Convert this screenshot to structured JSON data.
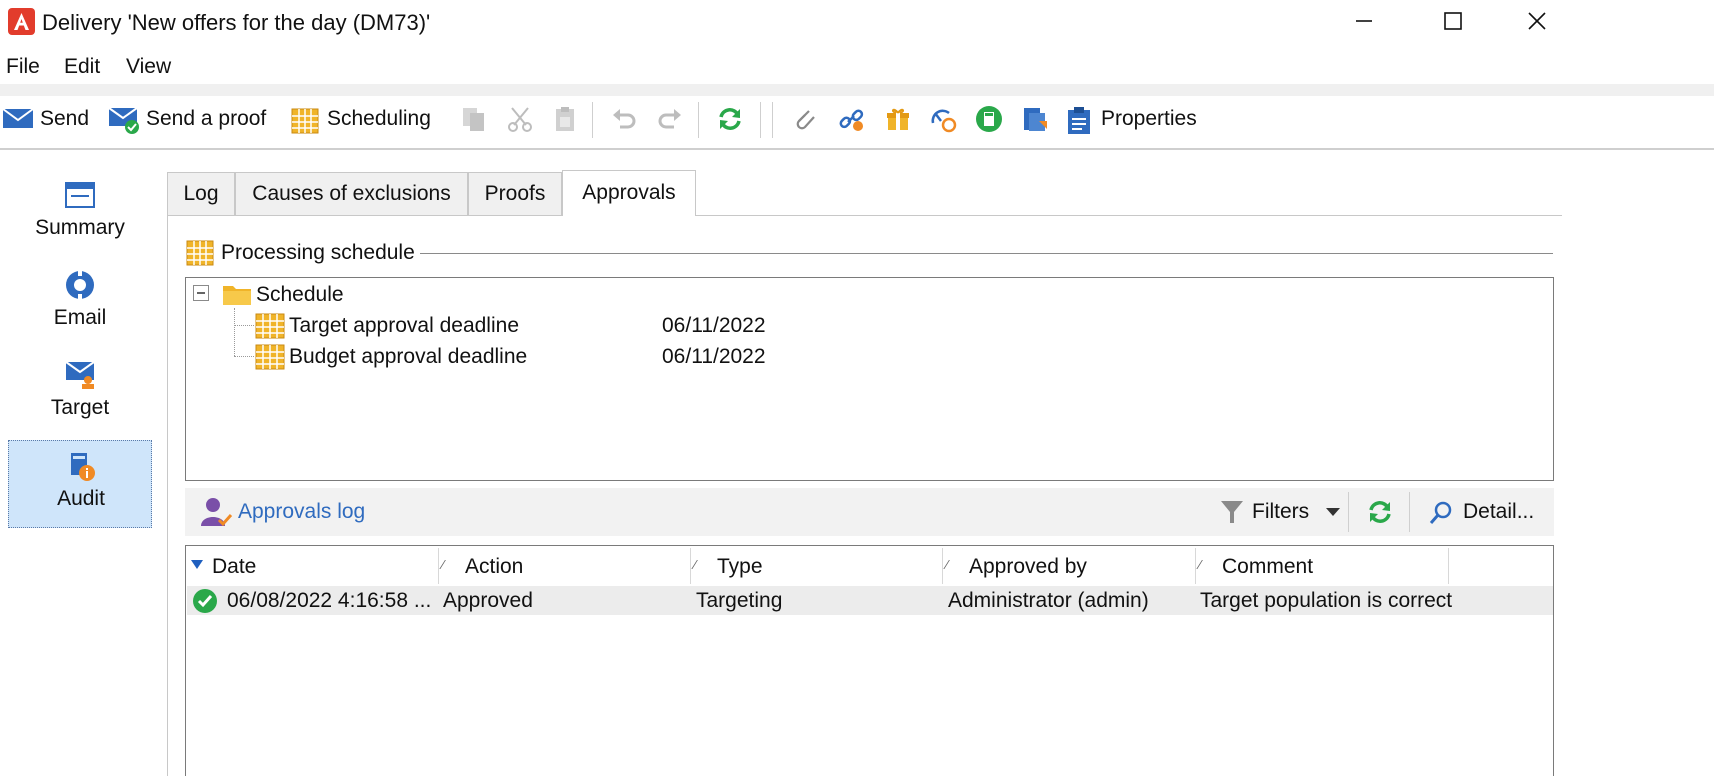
{
  "window": {
    "title": "Delivery 'New offers for the day (DM73)'",
    "controls": [
      "minimize",
      "maximize",
      "close"
    ]
  },
  "menu": {
    "file": "File",
    "edit": "Edit",
    "view": "View"
  },
  "toolbar": {
    "send": "Send",
    "send_proof": "Send a proof",
    "scheduling": "Scheduling",
    "properties": "Properties"
  },
  "nav": {
    "summary": "Summary",
    "email": "Email",
    "target": "Target",
    "audit": "Audit",
    "selected": "Audit"
  },
  "tabs": {
    "log": "Log",
    "causes": "Causes of exclusions",
    "proofs": "Proofs",
    "approvals": "Approvals",
    "active": "Approvals"
  },
  "schedule": {
    "section_title": "Processing schedule",
    "root": "Schedule",
    "items": [
      {
        "label": "Target approval deadline",
        "date": "06/11/2022"
      },
      {
        "label": "Budget approval deadline",
        "date": "06/11/2022"
      }
    ]
  },
  "approvals_log": {
    "title": "Approvals log",
    "filters": "Filters",
    "detail": "Detail...",
    "columns": [
      "Date",
      "Action",
      "Type",
      "Approved by",
      "Comment"
    ],
    "rows": [
      {
        "status": "approved",
        "date": "06/08/2022 4:16:58 ...",
        "action": "Approved",
        "type": "Targeting",
        "approved_by": "Administrator (admin)",
        "comment": "Target population is correct"
      }
    ]
  },
  "colors": {
    "accent": "#2f6bbf",
    "nav_selected_bg": "#cfe5fa",
    "logo": "#e23c2c",
    "refresh": "#2aa84a",
    "calendar": "#f0b429"
  }
}
